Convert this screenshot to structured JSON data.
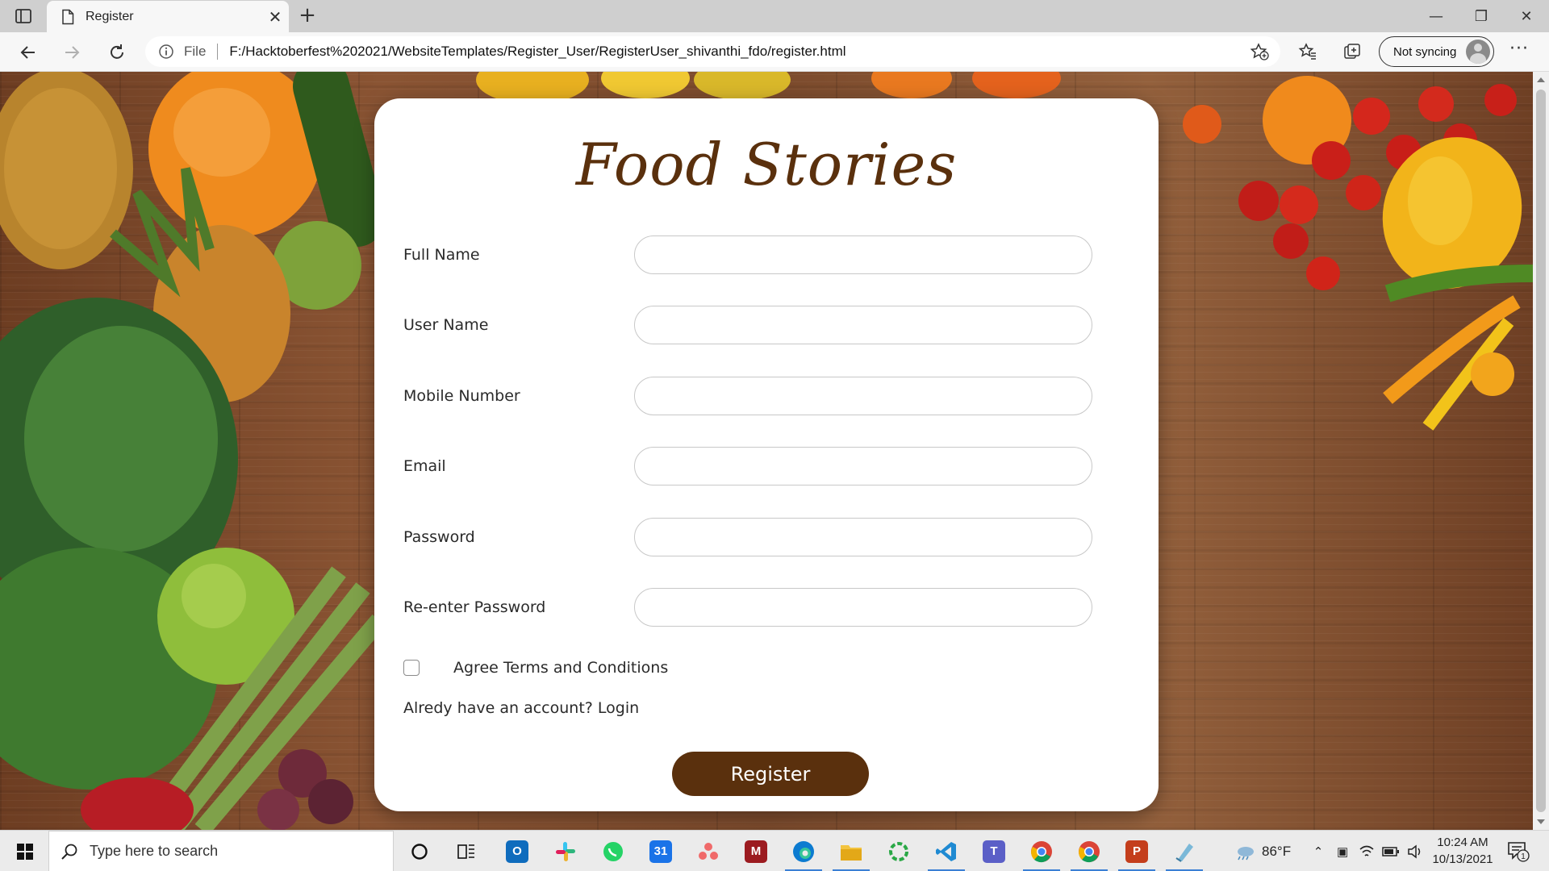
{
  "browser": {
    "tab_title": "Register",
    "address_scheme": "File",
    "url": "F:/Hacktoberfest%202021/WebsiteTemplates/Register_User/RegisterUser_shivanthi_fdo/register.html",
    "sync_label": "Not syncing"
  },
  "page": {
    "brand": "Food Stories",
    "fields": [
      {
        "label": "Full Name",
        "value": ""
      },
      {
        "label": "User Name",
        "value": ""
      },
      {
        "label": "Mobile Number",
        "value": ""
      },
      {
        "label": "Email",
        "value": ""
      },
      {
        "label": "Password",
        "value": ""
      },
      {
        "label": "Re-enter Password",
        "value": ""
      }
    ],
    "terms_label": "Agree Terms and Conditions",
    "terms_checked": false,
    "login_prompt": "Alredy have an account? Login",
    "register_label": "Register"
  },
  "taskbar": {
    "search_placeholder": "Type here to search",
    "weather": "86°F",
    "time": "10:24 AM",
    "date": "10/13/2021",
    "notification_count": "1"
  },
  "colors": {
    "brand": "#5a300d",
    "button": "#5a300d",
    "wood": "#7b4a2c"
  }
}
